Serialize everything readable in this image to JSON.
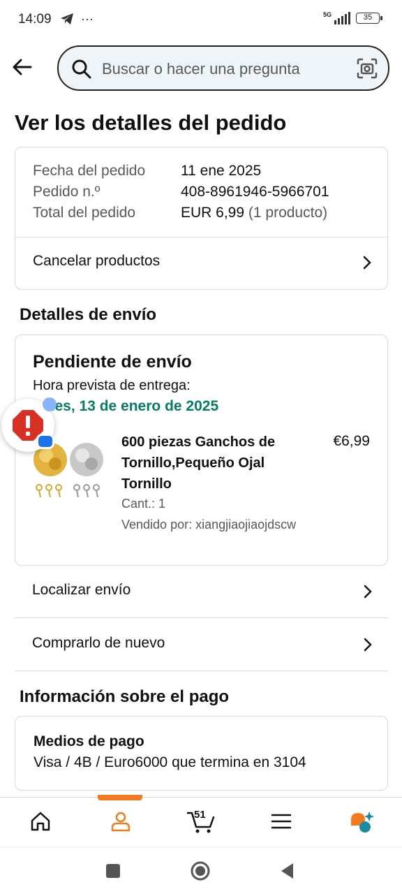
{
  "status_bar": {
    "time": "14:09",
    "network": "5G",
    "battery": "35"
  },
  "search": {
    "placeholder": "Buscar o hacer una pregunta"
  },
  "page_title": "Ver los detalles del pedido",
  "order": {
    "date_label": "Fecha del pedido",
    "date_value": "11 ene 2025",
    "number_label": "Pedido n.º",
    "number_value": "408-8961946-5966701",
    "total_label": "Total del pedido",
    "total_value": "EUR 6,99",
    "total_items": "(1 producto)",
    "cancel_label": "Cancelar productos"
  },
  "shipping": {
    "section_title": "Detalles de envío",
    "status": "Pendiente de envío",
    "eta_label": "Hora prevista de entrega:",
    "eta_date": "lunes, 13 de enero de 2025",
    "product": {
      "title": "600 piezas Ganchos de Tornillo,Pequeño Ojal Tornillo",
      "price": "€6,99",
      "quantity": "Cant.: 1",
      "seller": "Vendido por: xiangjiaojiaojdscw"
    }
  },
  "actions": {
    "track_label": "Localizar envío",
    "rebuy_label": "Comprarlo de nuevo"
  },
  "payment": {
    "section_title": "Información sobre el pago",
    "method_title": "Medios de pago",
    "method_value": "Visa / 4B / Euro6000  que termina en 3104"
  },
  "tabbar": {
    "cart_count": "51",
    "active_tab": "account"
  },
  "colors": {
    "accent": "#f47a20",
    "eta_green": "#067d62",
    "alert_red": "#d93025"
  }
}
